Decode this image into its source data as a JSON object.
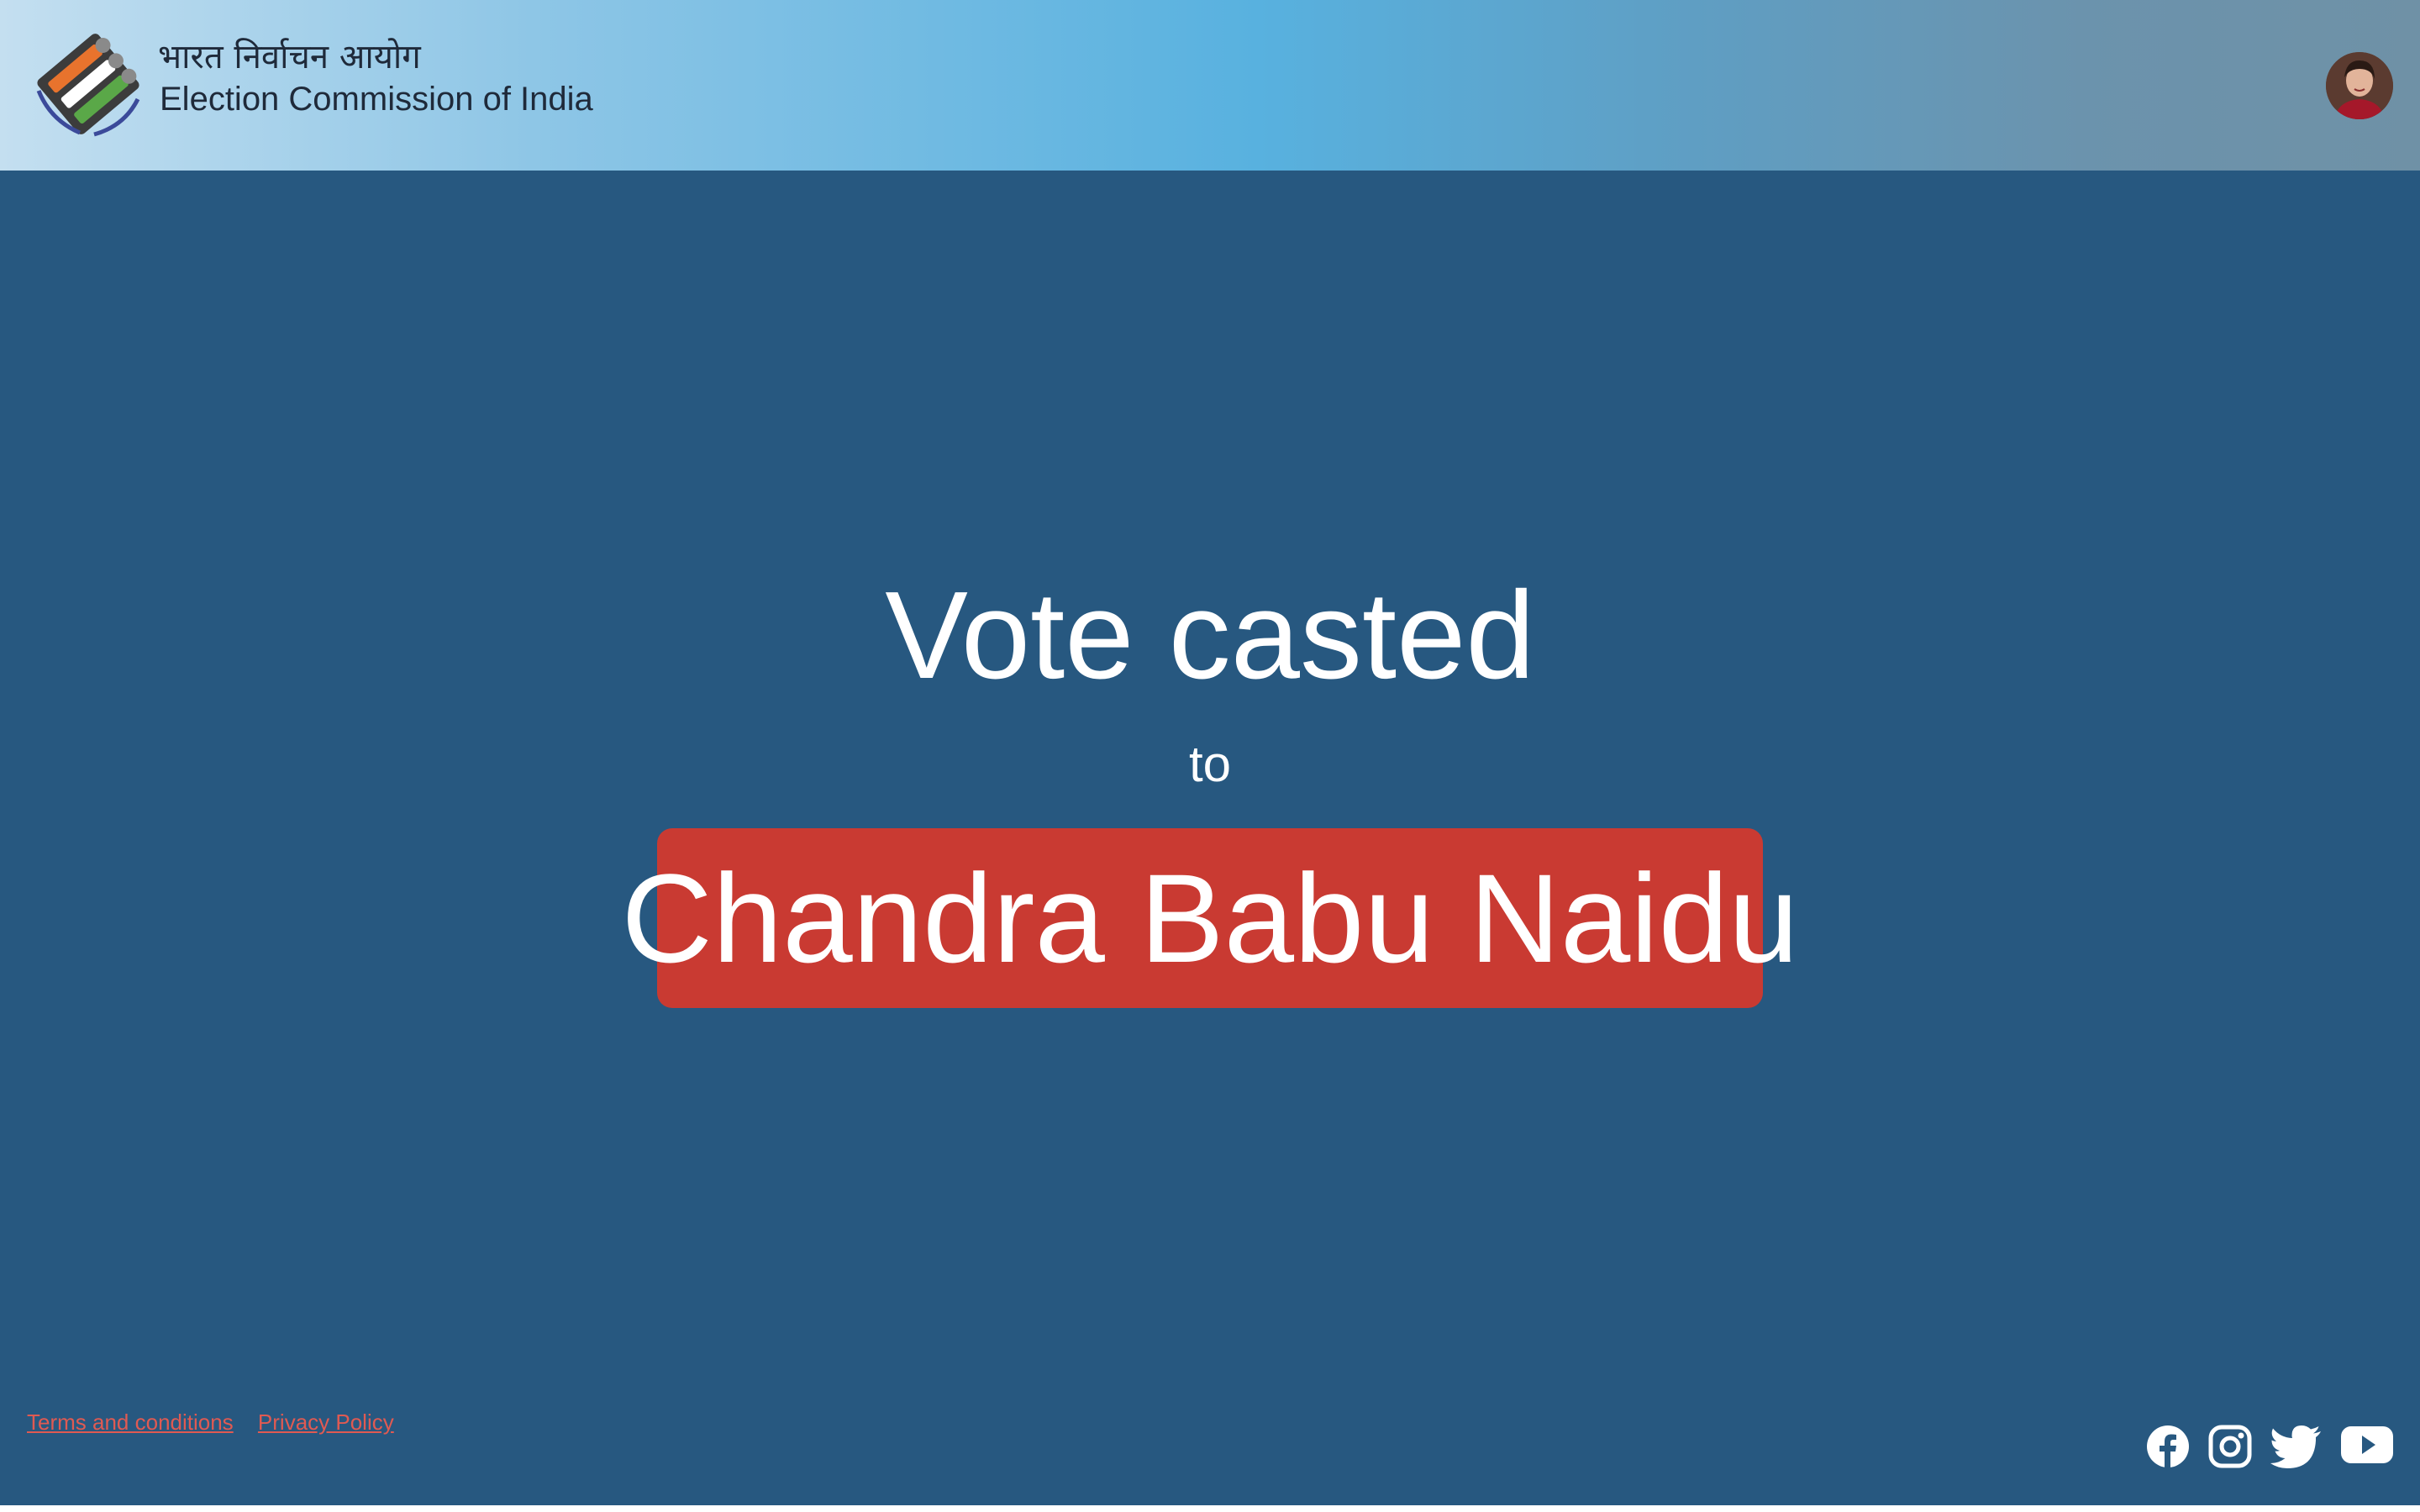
{
  "header": {
    "org_name_hindi": "भारत निर्वाचन आयोग",
    "org_name_english": "Election Commission of India",
    "logo_icon": "eci-logo-icon",
    "avatar_icon": "user-avatar"
  },
  "main": {
    "headline": "Vote casted",
    "connector": "to",
    "candidate_name": "Chandra Babu Naidu"
  },
  "footer": {
    "links": [
      {
        "label": "Terms and conditions"
      },
      {
        "label": "Privacy Policy"
      }
    ],
    "social": [
      "facebook-icon",
      "instagram-icon",
      "twitter-icon",
      "youtube-icon"
    ]
  },
  "colors": {
    "background": "#275880",
    "candidate_badge": "#c93a32",
    "link": "#e05a52",
    "text": "#ffffff"
  }
}
